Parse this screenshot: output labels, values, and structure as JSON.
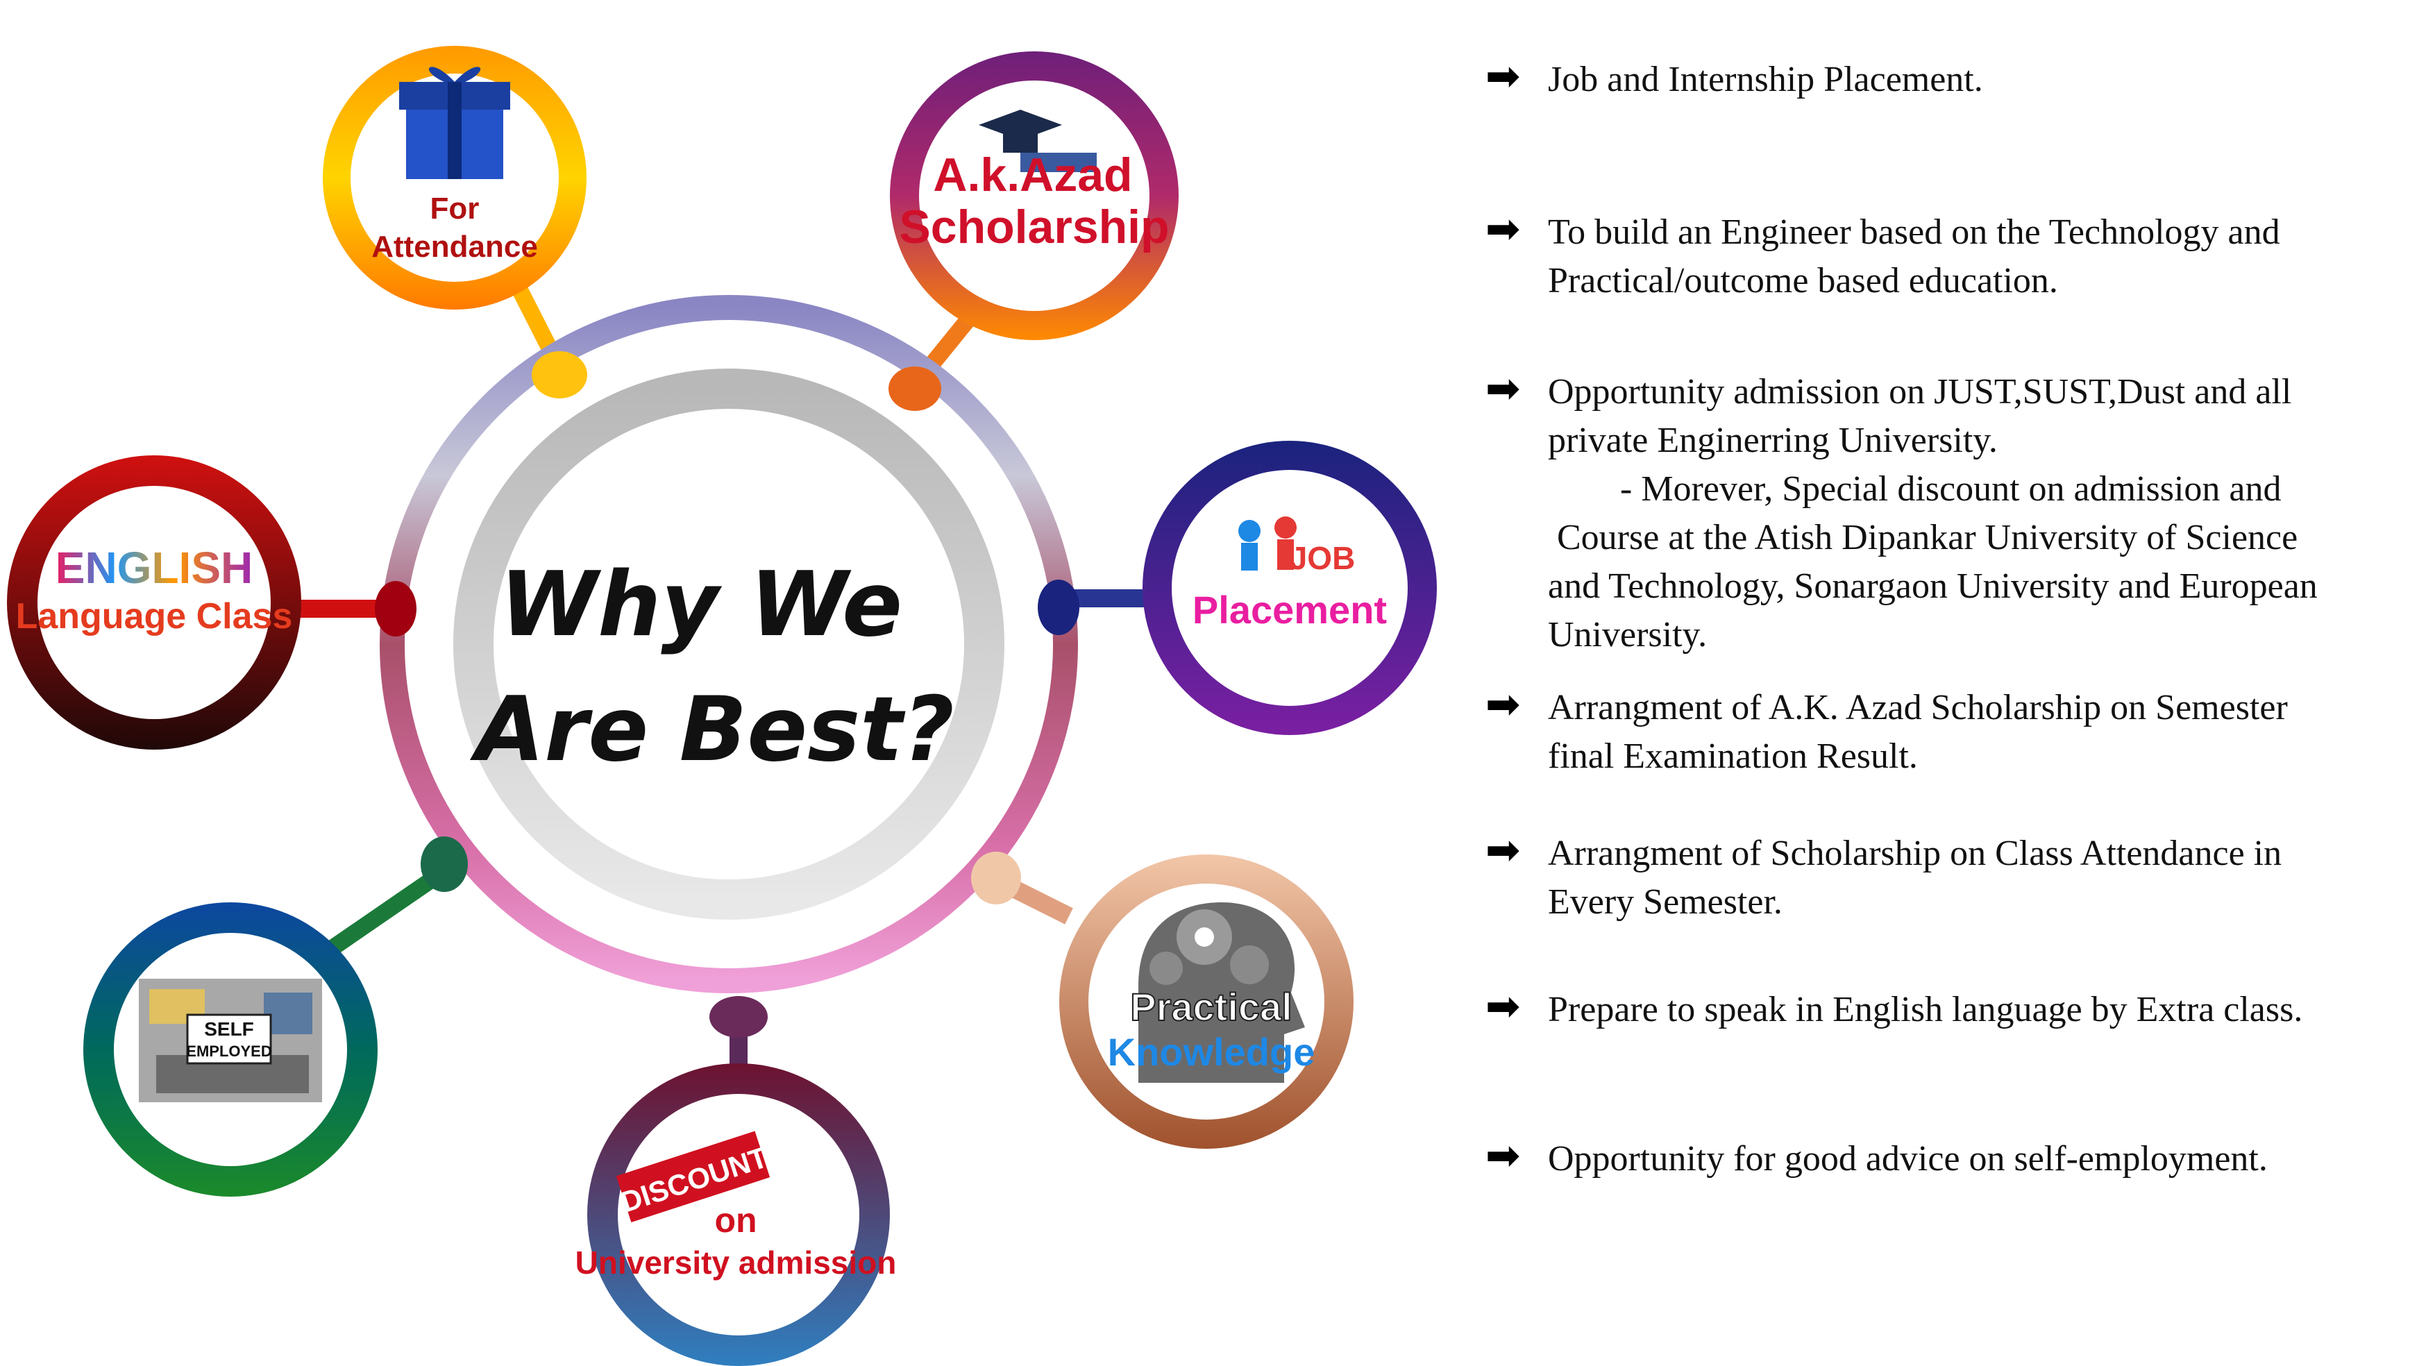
{
  "center": {
    "line1": "Why We",
    "line2": "Are Best?"
  },
  "nodes": {
    "attendance": {
      "line1": "For",
      "line2": "Attendance",
      "icon": "gift-box-icon"
    },
    "scholarship": {
      "line1": "A.k.Azad",
      "line2": "Scholarship",
      "icon": "graduation-cap-icon"
    },
    "placement": {
      "badge": "JOB",
      "label": "Placement",
      "icon": "handshake-icon"
    },
    "practical": {
      "line1": "Practical",
      "line2": "Knowledge",
      "icon": "gears-head-icon"
    },
    "discount": {
      "badge": "DISCOUNT",
      "line1": "on",
      "line2": "University admission"
    },
    "self_employed": {
      "line1": "SELF",
      "line2": "EMPLOYED",
      "icon": "laptop-desk-icon"
    },
    "english": {
      "line1": "ENGLISH",
      "line2": "Language Class"
    }
  },
  "bullets": [
    {
      "lines": [
        "Job and Internship Placement."
      ]
    },
    {
      "lines": [
        "To build an Engineer based on the Technology and",
        "Practical/outcome based education."
      ]
    },
    {
      "lines": [
        "Opportunity admission on JUST,SUST,Dust and all",
        "private Enginerring University.",
        "        - Morever, Special discount on admission and",
        " Course at the Atish Dipankar University of Science",
        "and Technology, Sonargaon University and European",
        "University."
      ]
    },
    {
      "lines": [
        "Arrangment of A.K. Azad Scholarship on Semester",
        "final Examination Result."
      ]
    },
    {
      "lines": [
        "Arrangment of Scholarship on Class Attendance in",
        "Every Semester."
      ]
    },
    {
      "lines": [
        "Prepare to speak in English language by Extra class."
      ]
    },
    {
      "lines": [
        "Opportunity for good advice on self-employment."
      ]
    }
  ],
  "arrow_glyph": "➡"
}
